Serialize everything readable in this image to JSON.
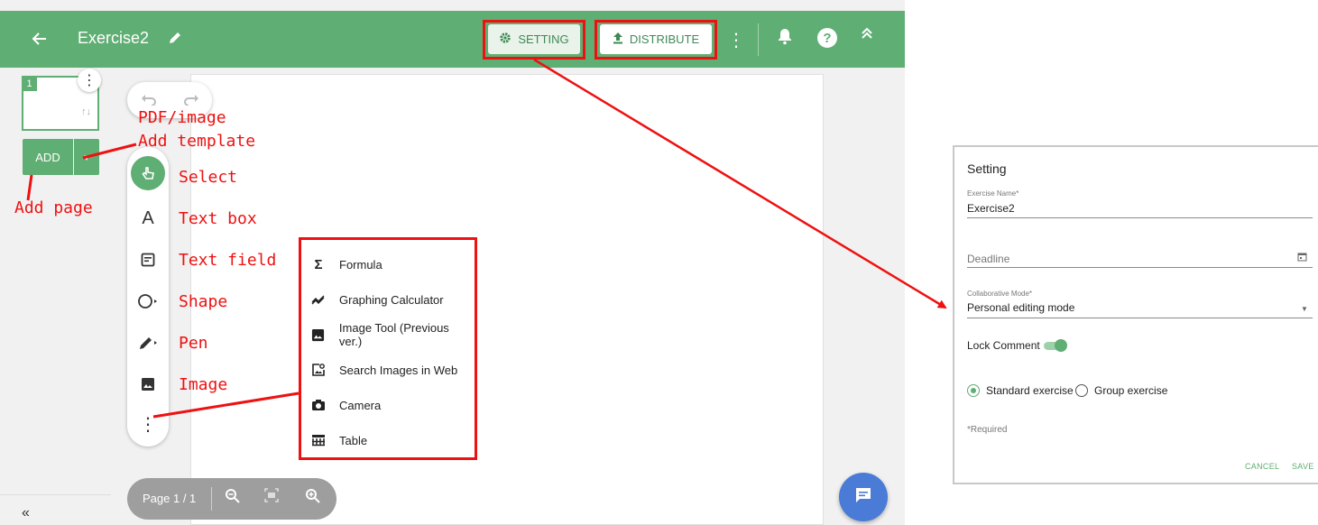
{
  "header": {
    "title": "Exercise2",
    "setting_label": "SETTING",
    "distribute_label": "DISTRIBUTE",
    "icons": [
      "arrow-back-icon",
      "pencil-icon",
      "gear-icon",
      "upload-icon",
      "more-vert-icon",
      "bell-icon",
      "help-icon",
      "chevron-double-up-icon"
    ]
  },
  "pages": {
    "thumb_number": "1",
    "add_label": "ADD",
    "collapse_label": "«"
  },
  "page_nav": {
    "page_label": "Page 1 / 1"
  },
  "annotations": {
    "pdf_image": "PDF/image",
    "add_template": "Add template",
    "add_page": "Add page",
    "select": "Select",
    "text_box": "Text box",
    "text_field": "Text field",
    "shape": "Shape",
    "pen": "Pen",
    "image": "Image"
  },
  "more_menu": {
    "items": [
      {
        "label": "Formula",
        "icon": "sigma-icon"
      },
      {
        "label": "Graphing Calculator",
        "icon": "graph-icon"
      },
      {
        "label": "Image Tool (Previous ver.)",
        "icon": "image-icon"
      },
      {
        "label": "Search Images in Web",
        "icon": "image-search-icon"
      },
      {
        "label": "Camera",
        "icon": "camera-icon"
      },
      {
        "label": "Table",
        "icon": "table-icon"
      }
    ]
  },
  "setting_dialog": {
    "title": "Setting",
    "exercise_name_label": "Exercise Name*",
    "exercise_name_value": "Exercise2",
    "deadline_placeholder": "Deadline",
    "collab_label": "Collaborative Mode*",
    "collab_value": "Personal editing mode",
    "lock_comment_label": "Lock Comment",
    "lock_comment_on": true,
    "radio_standard": "Standard exercise",
    "radio_group": "Group exercise",
    "selected_type": "Standard exercise",
    "required_note": "*Required",
    "cancel_label": "CANCEL",
    "save_label": "SAVE"
  },
  "colors": {
    "brand_green": "#5fae73",
    "annotation_red": "#ee1111",
    "chat_blue": "#4a7bd6"
  }
}
